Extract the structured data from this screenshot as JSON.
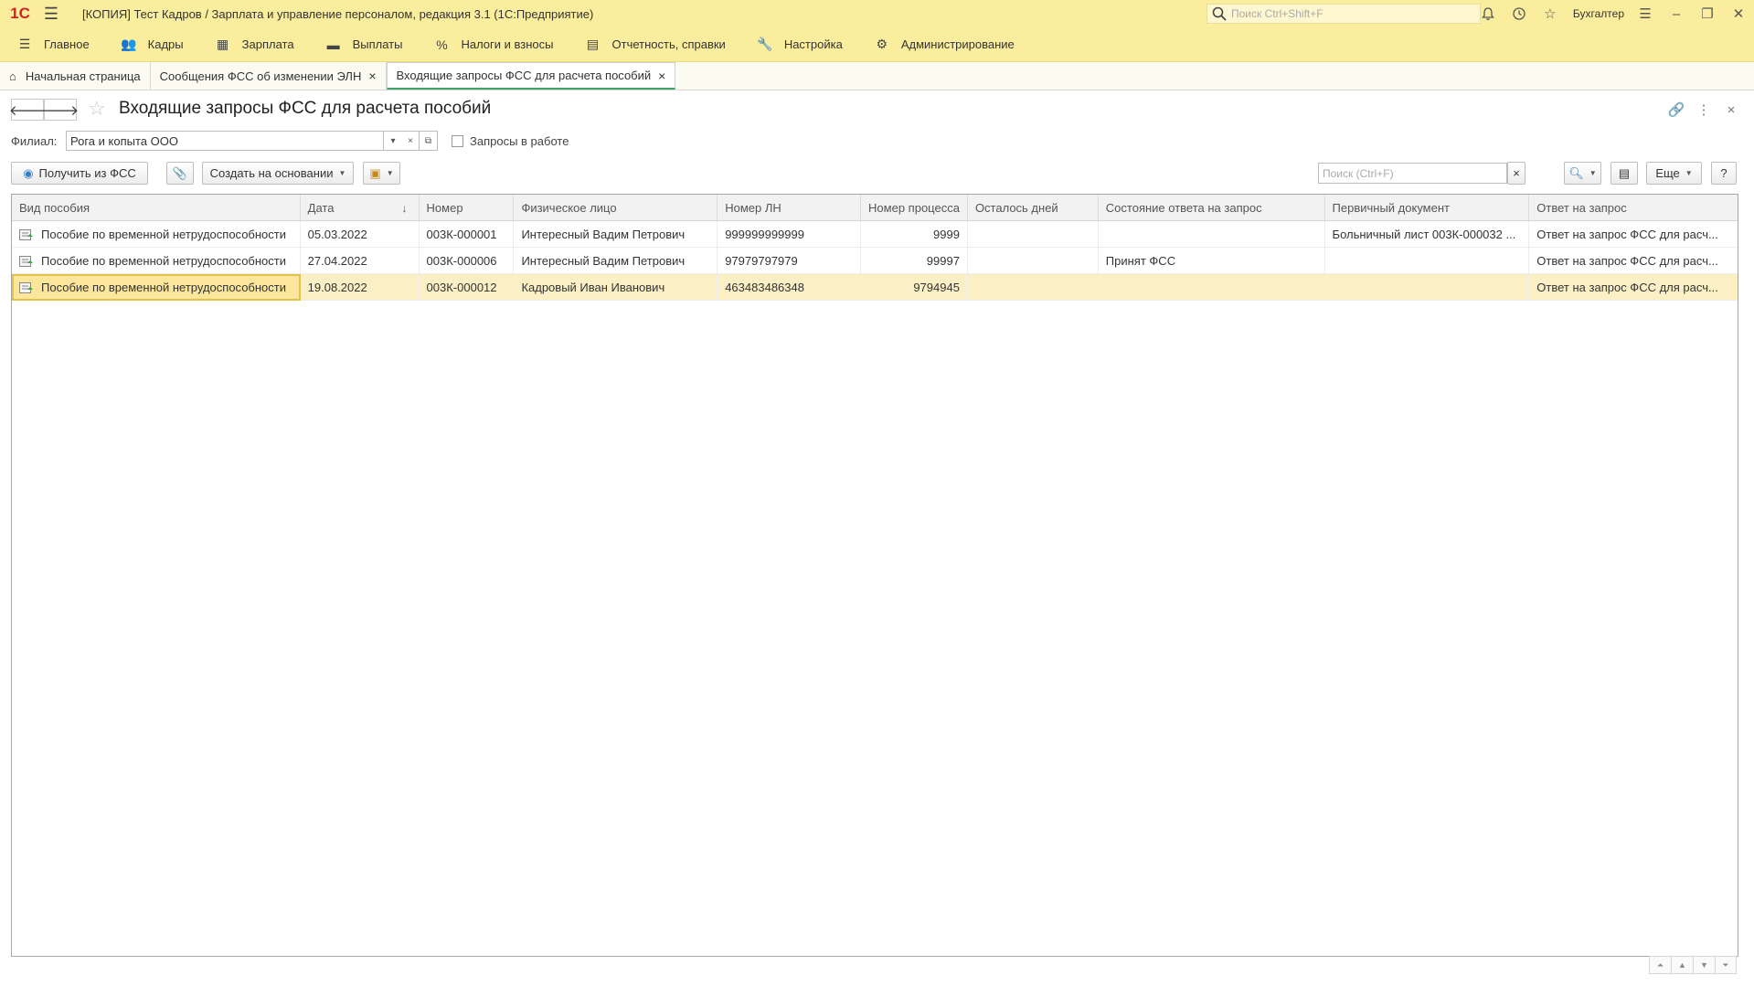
{
  "app": {
    "logo_text": "1С",
    "window_title": "[КОПИЯ] Тест Кадров / Зарплата и управление персоналом, редакция 3.1  (1С:Предприятие)",
    "search_placeholder": "Поиск Ctrl+Shift+F",
    "user": "Бухгалтер",
    "accent_color": "#fbed9e"
  },
  "sections": [
    {
      "label": "Главное",
      "icon": "menu-icon"
    },
    {
      "label": "Кадры",
      "icon": "people-icon"
    },
    {
      "label": "Зарплата",
      "icon": "calculator-icon"
    },
    {
      "label": "Выплаты",
      "icon": "wallet-icon"
    },
    {
      "label": "Налоги и взносы",
      "icon": "percent-icon"
    },
    {
      "label": "Отчетность, справки",
      "icon": "report-icon"
    },
    {
      "label": "Настройка",
      "icon": "wrench-icon"
    },
    {
      "label": "Администрирование",
      "icon": "gear-icon"
    }
  ],
  "tabs": [
    {
      "label": "Начальная страница"
    },
    {
      "label": "Сообщения ФСС об изменении ЭЛН"
    },
    {
      "label": "Входящие запросы ФСС для расчета пособий"
    }
  ],
  "form": {
    "title": "Входящие запросы ФСС для расчета пособий",
    "filial_label": "Филиал:",
    "filial_value": "Рога и копыта ООО",
    "in_work_label": "Запросы в работе",
    "get_from_fss": "Получить из ФСС",
    "create_based_on": "Создать на основании",
    "search_placeholder": "Поиск (Ctrl+F)",
    "more": "Еще",
    "help": "?"
  },
  "table": {
    "columns": [
      "Вид пособия",
      "Дата",
      "Номер",
      "Физическое лицо",
      "Номер ЛН",
      "Номер процесса",
      "Осталось дней",
      "Состояние ответа на запрос",
      "Первичный документ",
      "Ответ на запрос"
    ],
    "rows": [
      [
        "Пособие по временной нетрудоспособности",
        "05.03.2022",
        "003К-000001",
        "Интересный Вадим Петрович",
        "999999999999",
        "9999",
        "",
        "",
        "Больничный лист 003К-000032 ...",
        "Ответ на запрос ФСС для расч..."
      ],
      [
        "Пособие по временной нетрудоспособности",
        "27.04.2022",
        "003К-000006",
        "Интересный Вадим Петрович",
        "97979797979",
        "99997",
        "",
        "Принят ФСС",
        "",
        "Ответ на запрос ФСС для расч..."
      ],
      [
        "Пособие по временной нетрудоспособности",
        "19.08.2022",
        "003К-000012",
        "Кадровый Иван Иванович",
        "463483486348",
        "9794945",
        "",
        "",
        "",
        "Ответ на запрос ФСС для расч..."
      ]
    ],
    "selected_row": 2,
    "sort_column": "Дата"
  }
}
